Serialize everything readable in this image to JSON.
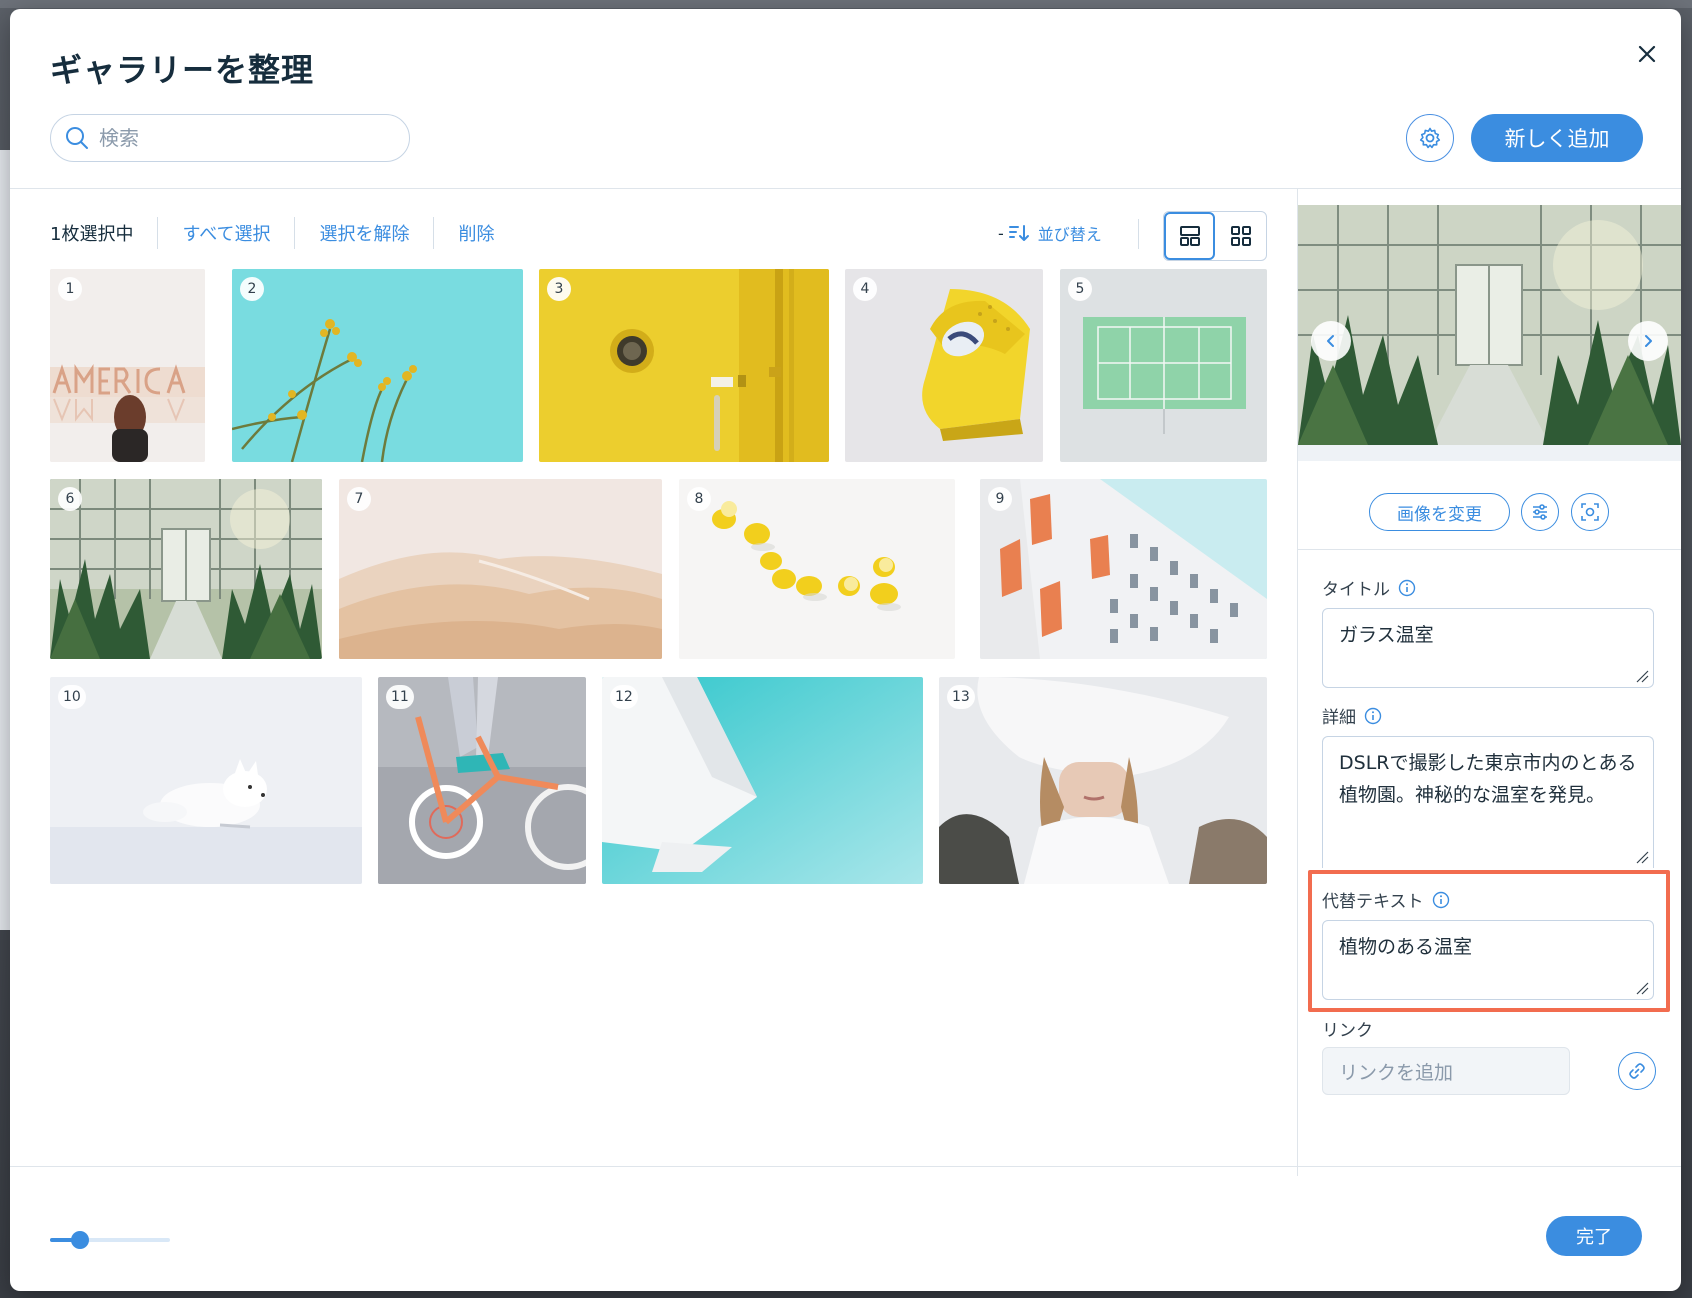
{
  "dialog": {
    "title": "ギャラリーを整理",
    "search_placeholder": "検索",
    "add_button": "新しく追加"
  },
  "toolbar": {
    "selected_count": "1枚選択中",
    "select_all": "すべて選択",
    "deselect": "選択を解除",
    "delete": "削除",
    "sort_dash": "-",
    "sort": "並び替え"
  },
  "gallery": {
    "items": [
      {
        "number": "1",
        "subject": "america-sign"
      },
      {
        "number": "2",
        "subject": "yellow-flowers-sky"
      },
      {
        "number": "3",
        "subject": "yellow-door"
      },
      {
        "number": "4",
        "subject": "yellow-sofa"
      },
      {
        "number": "5",
        "subject": "tennis-court"
      },
      {
        "number": "6",
        "subject": "glass-greenhouse",
        "selected": true
      },
      {
        "number": "7",
        "subject": "desert-dunes"
      },
      {
        "number": "8",
        "subject": "lemons"
      },
      {
        "number": "9",
        "subject": "building"
      },
      {
        "number": "10",
        "subject": "arctic-fox"
      },
      {
        "number": "11",
        "subject": "bicycle"
      },
      {
        "number": "12",
        "subject": "white-sail"
      },
      {
        "number": "13",
        "subject": "woman-white-cloth"
      }
    ]
  },
  "panel": {
    "change_image": "画像を変更",
    "title_label": "タイトル",
    "title_value": "ガラス温室",
    "description_label": "詳細",
    "description_value": "DSLRで撮影した東京市内のとある植物園。神秘的な温室を発見。",
    "alt_label": "代替テキスト",
    "alt_value": "植物のある温室",
    "link_label": "リンク",
    "link_placeholder": "リンクを追加"
  },
  "footer": {
    "done": "完了",
    "zoom_level": 0.25
  },
  "colors": {
    "accent": "#3b8de0",
    "highlight": "#f26c4f"
  }
}
